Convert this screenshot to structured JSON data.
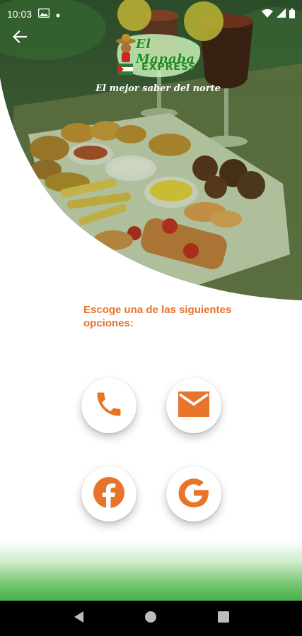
{
  "status_bar": {
    "time": "10:03",
    "icons": [
      "gallery-icon",
      "dot-icon",
      "wifi-icon",
      "signal-icon",
      "battery-icon"
    ]
  },
  "header": {
    "back_icon": "arrow-back-icon",
    "brand_line1": "El Manaba",
    "brand_line2": "EXPRESS",
    "tagline": "El mejor saber del norte"
  },
  "main": {
    "prompt": "Escoge una de las siguientes opciones:",
    "options": [
      {
        "name": "phone",
        "icon": "phone-icon"
      },
      {
        "name": "email",
        "icon": "email-icon"
      },
      {
        "name": "facebook",
        "icon": "facebook-icon"
      },
      {
        "name": "google",
        "icon": "google-icon"
      }
    ]
  },
  "navigation": {
    "items": [
      "back-triangle-icon",
      "home-circle-icon",
      "recents-square-icon"
    ]
  },
  "colors": {
    "accent": "#e8742a",
    "brand_green": "#1e8a22",
    "band_green": "#4caf50"
  }
}
